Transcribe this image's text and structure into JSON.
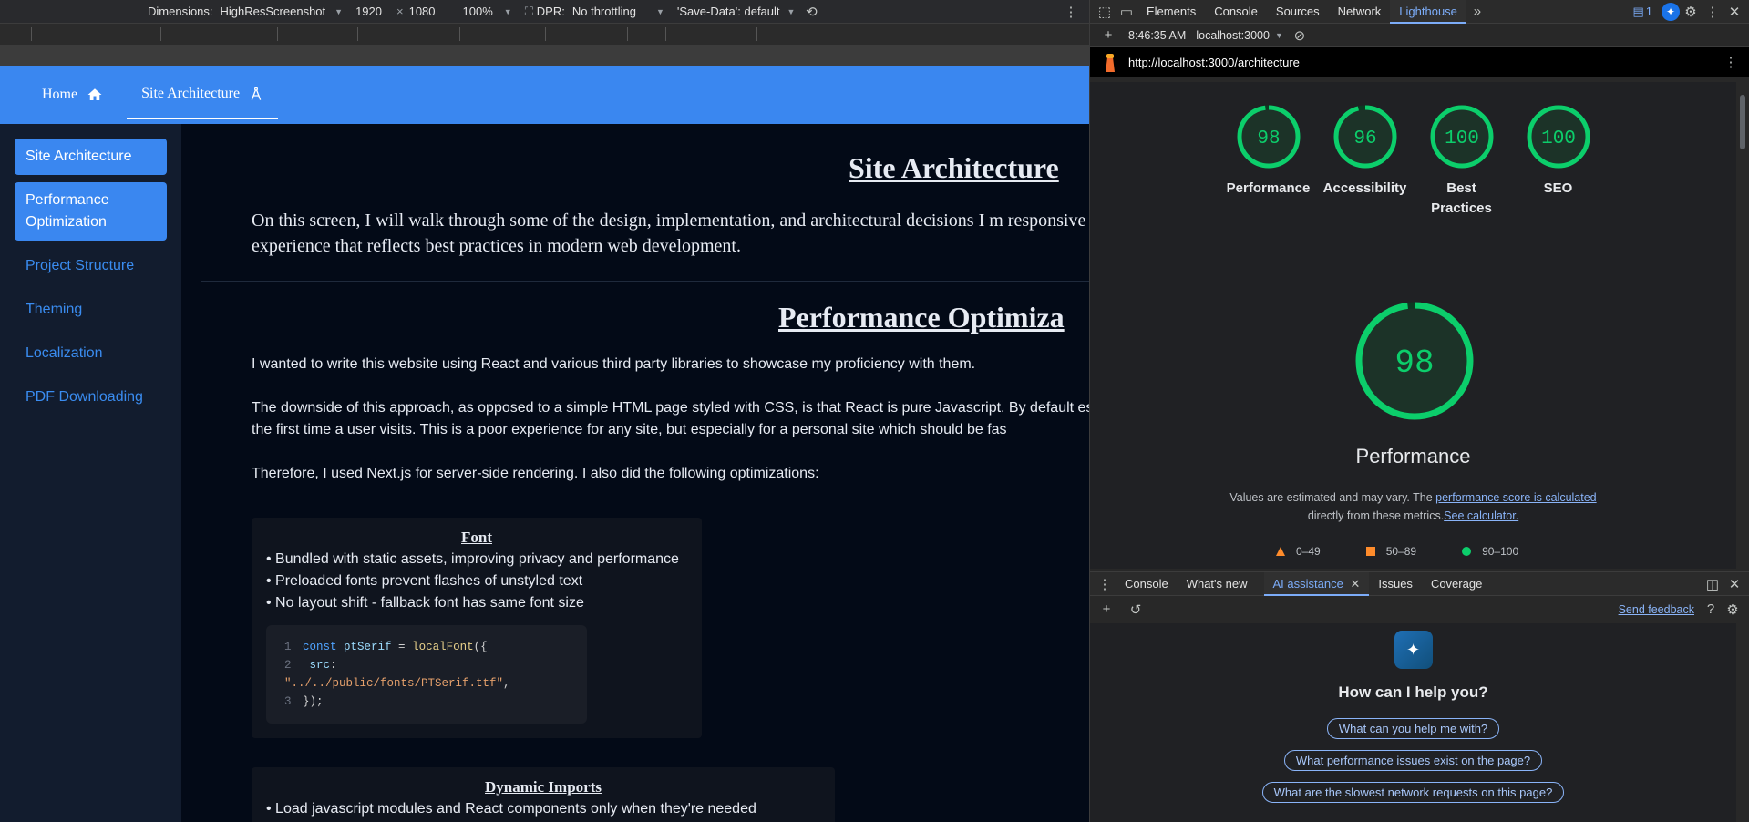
{
  "emulation": {
    "dimensions_label": "Dimensions:",
    "device": "HighResScreenshot",
    "width": "1920",
    "times": "×",
    "height": "1080",
    "zoom": "100%",
    "dpr_label": "DPR:",
    "throttling": "No throttling",
    "save_data": "'Save-Data': default"
  },
  "site": {
    "nav": [
      {
        "label": "Home",
        "icon": "home-icon"
      },
      {
        "label": "Site Architecture",
        "icon": "compass-icon"
      }
    ],
    "sidebar": [
      {
        "label": "Site Architecture",
        "selected": true
      },
      {
        "label": "Performance Optimization",
        "selected": true
      },
      {
        "label": "Project Structure",
        "selected": false
      },
      {
        "label": "Theming",
        "selected": false
      },
      {
        "label": "Localization",
        "selected": false
      },
      {
        "label": "PDF Downloading",
        "selected": false
      }
    ],
    "title": "Site Architecture",
    "lead": "On this screen, I will walk through some of the design, implementation, and architectural decisions I m responsive experience that reflects best practices in modern web development.",
    "perf_title": "Performance Optimiza",
    "p1": "I wanted to write this website using React and various third party libraries to showcase my proficiency with them.",
    "p2": "The downside of this approach, as opposed to a simple HTML page styled with CSS, is that React is pure Javascript. By default especially the first time a user visits. This is a poor experience for any site, but especially for a personal site which should be fas",
    "p3": "Therefore, I used Next.js for server-side rendering. I also did the following optimizations:",
    "font_card": {
      "title": "Font",
      "items": [
        "• Bundled with static assets, improving privacy and performance",
        "• Preloaded fonts prevent flashes of unstyled text",
        "• No layout shift - fallback font has same font size"
      ],
      "code": {
        "ln1": "1",
        "ln2": "2",
        "ln3": "3",
        "kw": "const",
        "var": "ptSerif",
        "eq": " = ",
        "fn": "localFont",
        "open": "({",
        "prop": "src",
        "colon": ": ",
        "str": "\"../../public/fonts/PTSerif.ttf\"",
        "comma": ",",
        "close": "});"
      }
    },
    "imports_card": {
      "title": "Dynamic Imports",
      "items": [
        "• Load javascript modules and React components only when they're needed"
      ]
    }
  },
  "devtools": {
    "tabs": [
      "Elements",
      "Console",
      "Sources",
      "Network",
      "Lighthouse"
    ],
    "active_tab": "Lighthouse",
    "issues_count": "1",
    "report_time": "8:46:35 AM - localhost:3000",
    "url": "http://localhost:3000/architecture",
    "scores": [
      {
        "label": "Performance",
        "value": "98"
      },
      {
        "label": "Accessibility",
        "value": "96"
      },
      {
        "label": "Best Practices",
        "value": "100"
      },
      {
        "label": "SEO",
        "value": "100"
      }
    ],
    "main_score": "98",
    "main_label": "Performance",
    "note_prefix": "Values are estimated and may vary. The ",
    "note_link1": "performance score is calculated",
    "note_mid": "directly from these metrics.",
    "note_link2": "See calculator.",
    "legend": [
      "0–49",
      "50–89",
      "90–100"
    ],
    "colors": {
      "pass": "#0cce6b",
      "average": "#ff8c2b",
      "fail": "#ff4e42",
      "accent": "#7cacf8"
    },
    "drawer_tabs": [
      "Console",
      "What's new",
      "AI assistance",
      "Issues",
      "Coverage"
    ],
    "drawer_active": "AI assistance",
    "send_feedback": "Send feedback",
    "ai_question": "How can I help you?",
    "ai_chips": [
      "What can you help me with?",
      "What performance issues exist on the page?",
      "What are the slowest network requests on this page?"
    ]
  }
}
